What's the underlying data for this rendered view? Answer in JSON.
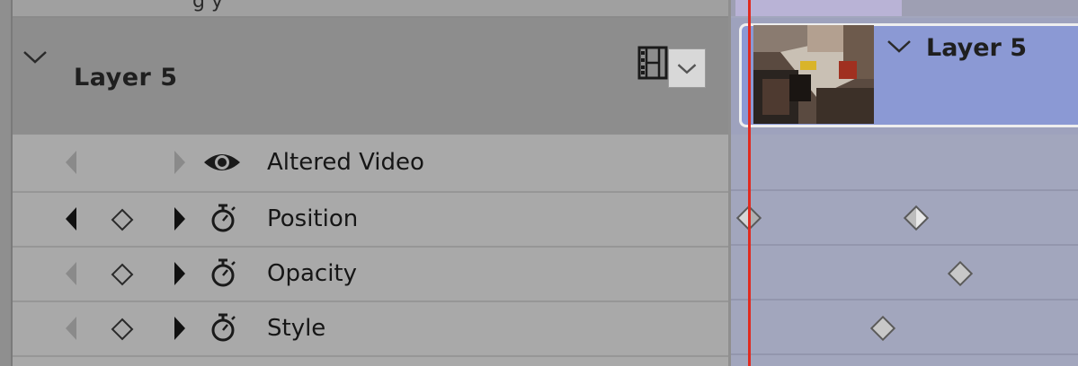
{
  "layer": {
    "title": "Layer 5",
    "clip_title": "Layer 5"
  },
  "properties": [
    {
      "label": "Altered Video",
      "icon": "eye-icon"
    },
    {
      "label": "Position",
      "icon": "stopwatch-icon"
    },
    {
      "label": "Opacity",
      "icon": "stopwatch-icon"
    },
    {
      "label": "Style",
      "icon": "stopwatch-icon"
    }
  ],
  "colors": {
    "playhead": "#e02a20",
    "clip": "#8b99d4",
    "track_bg": "#a2a6bd",
    "panel_bg": "#a8a8a8",
    "header_bg": "#8d8d8d"
  }
}
